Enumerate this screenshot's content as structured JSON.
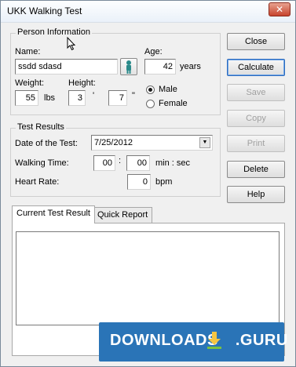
{
  "window": {
    "title": "UKK Walking Test",
    "close_glyph": "✕"
  },
  "person": {
    "group_title": "Person Information",
    "name_label": "Name:",
    "name_value": "ssdd sdasd",
    "person_icon": "person-icon",
    "age_label": "Age:",
    "age_value": "42",
    "age_unit": "years",
    "weight_label": "Weight:",
    "weight_value": "55",
    "weight_unit": "lbs",
    "height_label": "Height:",
    "height_ft": "3",
    "ft_mark": "'",
    "height_in": "7",
    "in_mark": "\"",
    "gender_options": [
      "Male",
      "Female"
    ],
    "gender_selected": "Male"
  },
  "results": {
    "group_title": "Test Results",
    "date_label": "Date of the Test:",
    "date_value": "7/25/2012",
    "walk_label": "Walking Time:",
    "walk_min": "00",
    "walk_sep": ":",
    "walk_sec": "00",
    "walk_unit": "min : sec",
    "hr_label": "Heart Rate:",
    "hr_value": "0",
    "hr_unit": "bpm"
  },
  "buttons": {
    "close": "Close",
    "calculate": "Calculate",
    "save": "Save",
    "copy": "Copy",
    "print": "Print",
    "delete": "Delete",
    "help": "Help"
  },
  "tabs": [
    "Current Test Result",
    "Quick Report"
  ],
  "watermark": {
    "text": "DOWNLOADS",
    "suffix": ".GURU",
    "brand_color": "#2a74b7",
    "accent_color": "#f4c542"
  }
}
